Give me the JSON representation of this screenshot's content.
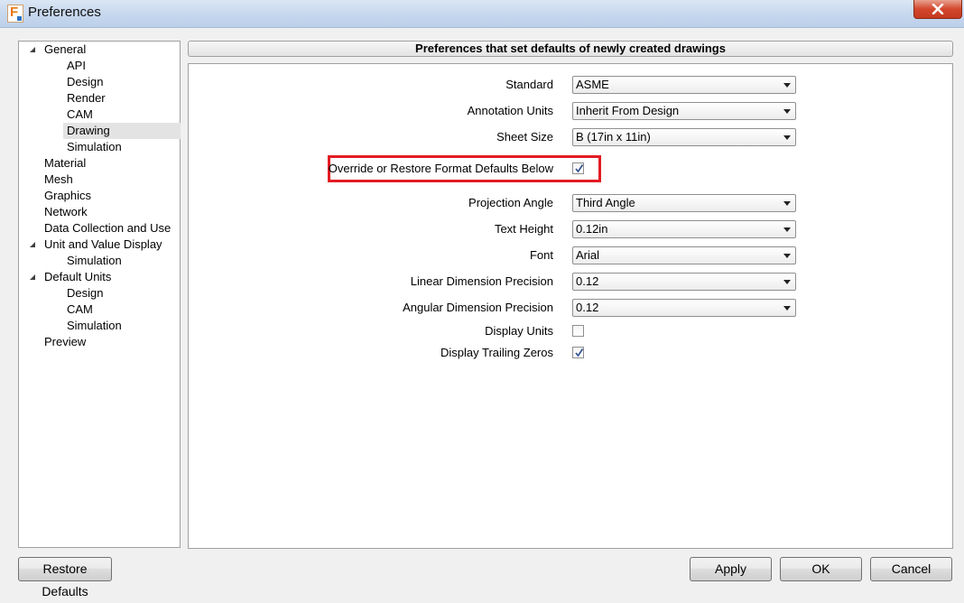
{
  "window": {
    "title": "Preferences"
  },
  "tree": [
    {
      "label": "General",
      "level": 0,
      "expanded": true
    },
    {
      "label": "API",
      "level": 1
    },
    {
      "label": "Design",
      "level": 1
    },
    {
      "label": "Render",
      "level": 1
    },
    {
      "label": "CAM",
      "level": 1
    },
    {
      "label": "Drawing",
      "level": 1,
      "selected": true
    },
    {
      "label": "Simulation",
      "level": 1
    },
    {
      "label": "Material",
      "level": 0
    },
    {
      "label": "Mesh",
      "level": 0
    },
    {
      "label": "Graphics",
      "level": 0
    },
    {
      "label": "Network",
      "level": 0
    },
    {
      "label": "Data Collection and Use",
      "level": 0
    },
    {
      "label": "Unit and Value Display",
      "level": 0,
      "expanded": true
    },
    {
      "label": "Simulation",
      "level": 1
    },
    {
      "label": "Default Units",
      "level": 0,
      "expanded": true
    },
    {
      "label": "Design",
      "level": 1
    },
    {
      "label": "CAM",
      "level": 1
    },
    {
      "label": "Simulation",
      "level": 1
    },
    {
      "label": "Preview",
      "level": 0
    }
  ],
  "panel": {
    "header": "Preferences that set defaults of newly created drawings",
    "standard": {
      "label": "Standard",
      "value": "ASME"
    },
    "annotation_units": {
      "label": "Annotation Units",
      "value": "Inherit From Design"
    },
    "sheet_size": {
      "label": "Sheet Size",
      "value": "B (17in x 11in)"
    },
    "override": {
      "label": "Override or Restore Format Defaults Below",
      "checked": true
    },
    "projection_angle": {
      "label": "Projection Angle",
      "value": "Third Angle"
    },
    "text_height": {
      "label": "Text Height",
      "value": "0.12in"
    },
    "font": {
      "label": "Font",
      "value": "Arial"
    },
    "linear_precision": {
      "label": "Linear Dimension Precision",
      "value": "0.12"
    },
    "angular_precision": {
      "label": "Angular Dimension Precision",
      "value": "0.12"
    },
    "display_units": {
      "label": "Display Units",
      "checked": false
    },
    "display_trailing_zeros": {
      "label": "Display Trailing Zeros",
      "checked": true
    }
  },
  "buttons": {
    "restore_defaults": "Restore Defaults",
    "apply": "Apply",
    "ok": "OK",
    "cancel": "Cancel"
  },
  "colors": {
    "highlight": "#e31b23",
    "title_bar": "#c7d8ee"
  }
}
